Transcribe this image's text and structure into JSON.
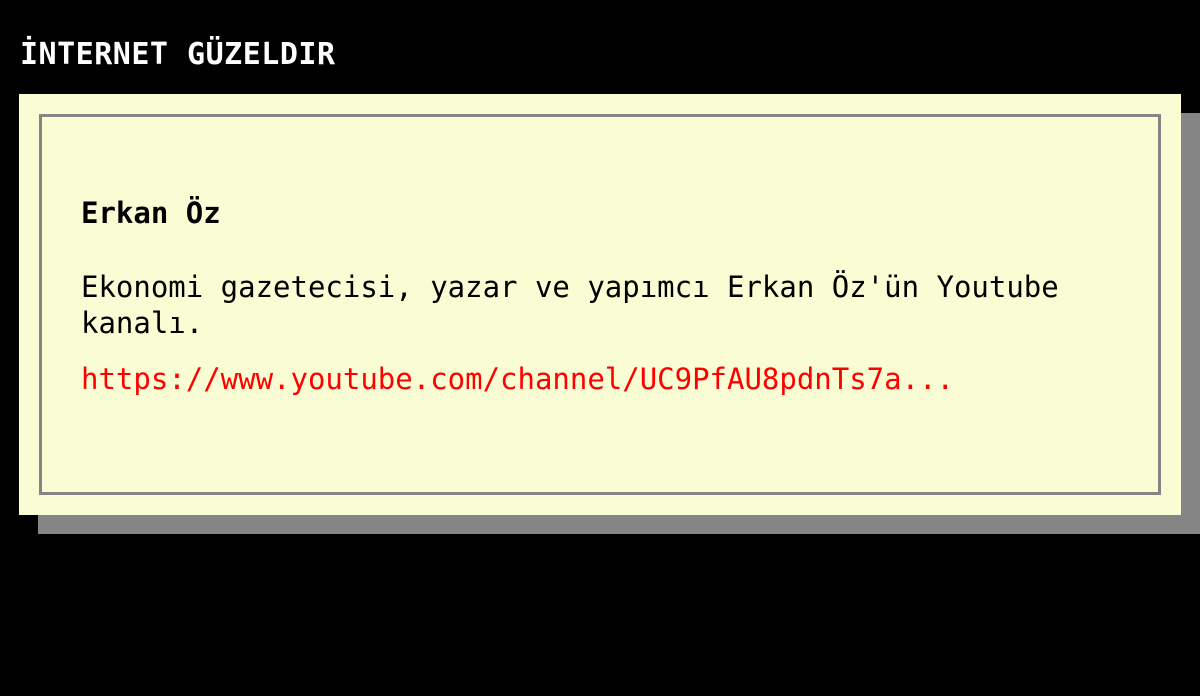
{
  "header": {
    "title": "İNTERNET GÜZELDIR"
  },
  "entry": {
    "title": "Erkan Öz",
    "description": "Ekonomi gazetecisi, yazar ve yapımcı Erkan Öz'ün Youtube kanalı.",
    "link_text": "https://www.youtube.com/channel/UC9PfAU8pdnTs7a..."
  },
  "colors": {
    "background": "#000000",
    "card": "#fafcd3",
    "card_border": "#858585",
    "link": "#ff0000"
  }
}
